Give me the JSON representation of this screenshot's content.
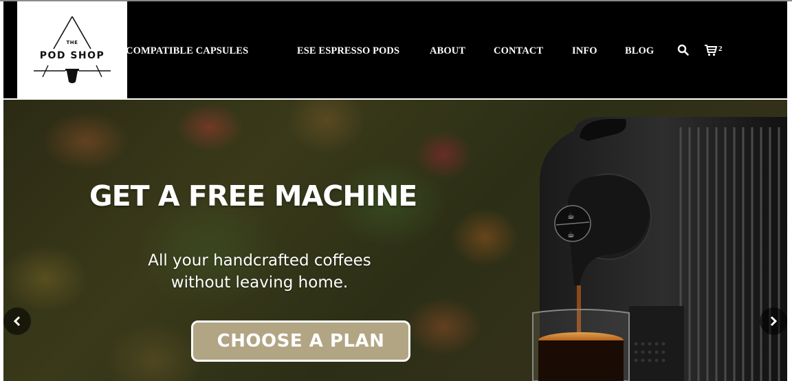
{
  "brand": {
    "logo_line1": "THE",
    "logo_line2": "POD SHOP"
  },
  "nav": {
    "items": [
      {
        "label": "O® COMPATIBLE CAPSULES"
      },
      {
        "label": "ESE ESPRESSO PODS"
      },
      {
        "label": "ABOUT"
      },
      {
        "label": "CONTACT"
      },
      {
        "label": "INFO"
      },
      {
        "label": "BLOG"
      }
    ],
    "search_icon": "search-icon",
    "cart_icon": "cart-icon",
    "cart_count": "2"
  },
  "hero": {
    "title": "GET A FREE MACHINE",
    "subtitle_line1": "All your handcrafted coffees",
    "subtitle_line2": "without leaving home.",
    "cta_label": "CHOOSE A PLAN",
    "prev_icon": "chevron-left-icon",
    "next_icon": "chevron-right-icon"
  },
  "colors": {
    "header_bg": "#000000",
    "cta_bg": "#b1a584",
    "text": "#ffffff"
  }
}
